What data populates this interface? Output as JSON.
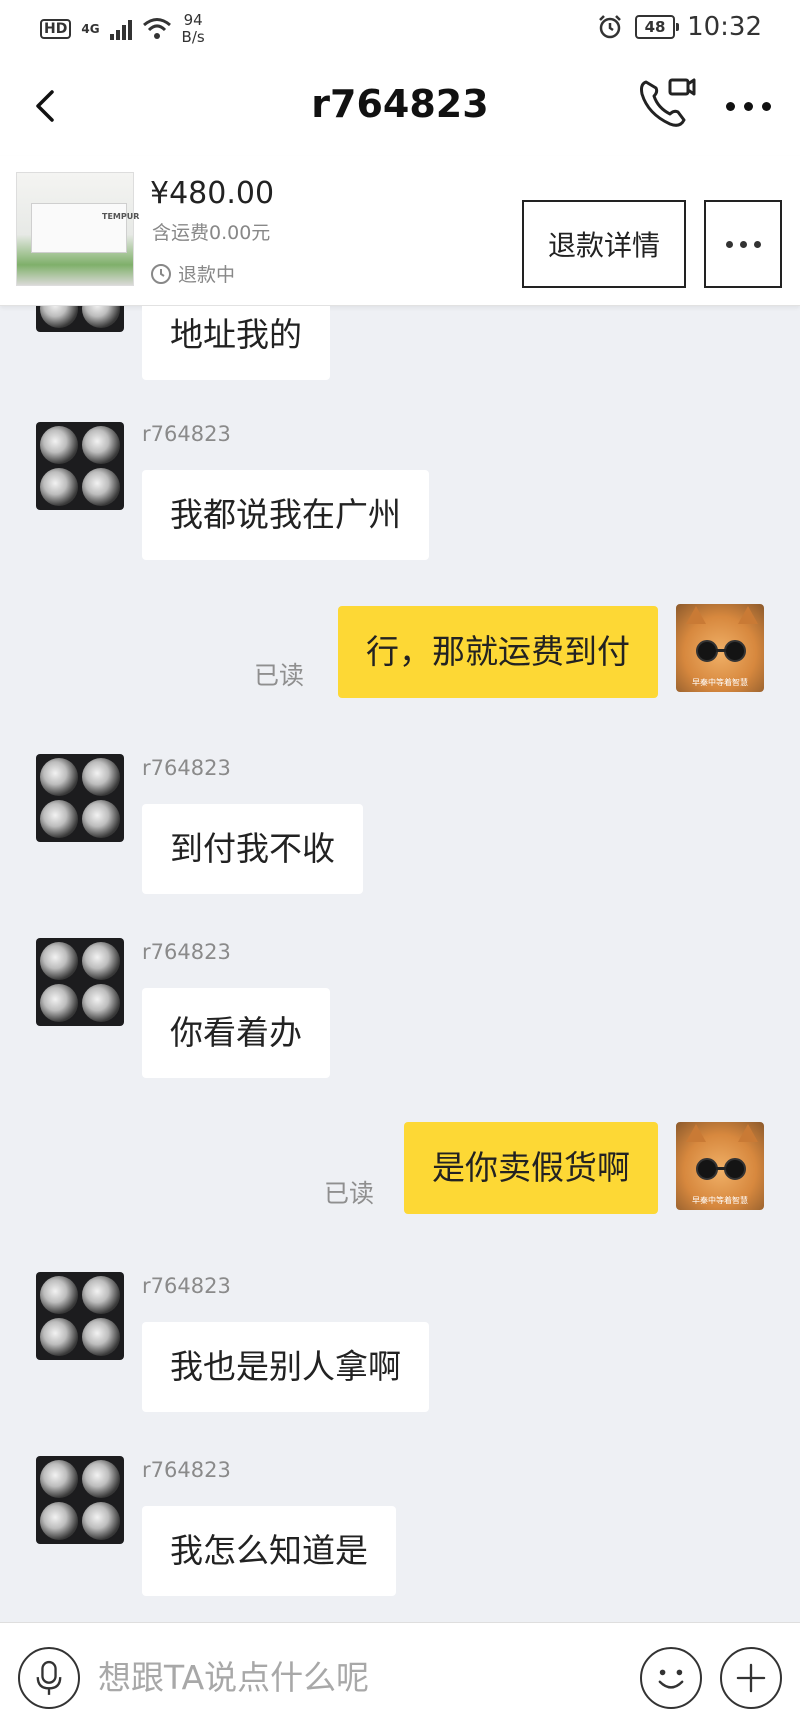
{
  "status_bar": {
    "hd": "HD",
    "network": "4G",
    "speed_value": "94",
    "speed_unit": "B/s",
    "battery": "48",
    "time": "10:32"
  },
  "nav": {
    "title": "r764823"
  },
  "order": {
    "price": "¥480.00",
    "shipping": "含运费0.00元",
    "status": "退款中",
    "refund_button": "退款详情",
    "thumbnail_brand": "TEMPUR"
  },
  "messages": [
    {
      "direction": "in",
      "sender": "",
      "text": "地址我的"
    },
    {
      "direction": "in",
      "sender": "r764823",
      "text": "我都说我在广州"
    },
    {
      "direction": "out",
      "read": "已读",
      "text": "行，那就运费到付"
    },
    {
      "direction": "in",
      "sender": "r764823",
      "text": "到付我不收"
    },
    {
      "direction": "in",
      "sender": "r764823",
      "text": "你看着办"
    },
    {
      "direction": "out",
      "read": "已读",
      "text": "是你卖假货啊"
    },
    {
      "direction": "in",
      "sender": "r764823",
      "text": "我也是别人拿啊"
    },
    {
      "direction": "in",
      "sender": "r764823",
      "text": "我怎么知道是"
    }
  ],
  "self_avatar_caption": "早秦中等着智慧",
  "input": {
    "placeholder": "想跟TA说点什么呢"
  },
  "colors": {
    "accent_bubble": "#fdd835",
    "chat_background": "#eef0f4"
  }
}
